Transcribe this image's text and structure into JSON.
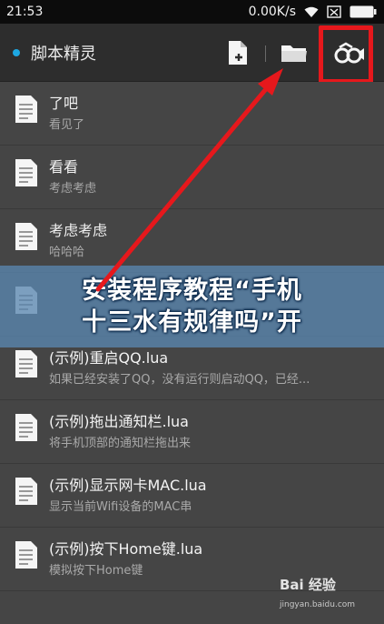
{
  "status_bar": {
    "time": "21:53",
    "net_speed": "0.00K/s"
  },
  "action_bar": {
    "app_title": "脚本精灵",
    "icons": [
      "new-script-icon",
      "folder-icon",
      "record-icon"
    ],
    "accent": "#1da7e2",
    "highlight_color": "#e6181c"
  },
  "scripts": [
    {
      "title": "了吧",
      "desc": "看见了"
    },
    {
      "title": "看看",
      "desc": "考虑考虑"
    },
    {
      "title": "考虑考虑",
      "desc": "哈哈哈"
    },
    {
      "title": "",
      "desc": ""
    },
    {
      "title": "(示例)重启QQ.lua",
      "desc": "如果已经安装了QQ，没有运行则启动QQ，已经..."
    },
    {
      "title": "(示例)拖出通知栏.lua",
      "desc": "将手机顶部的通知栏拖出来"
    },
    {
      "title": "(示例)显示网卡MAC.lua",
      "desc": "显示当前Wifi设备的MAC串"
    },
    {
      "title": "(示例)按下Home键.lua",
      "desc": "模拟按下Home键"
    }
  ],
  "overlay": {
    "line1": "安装程序教程“手机",
    "line2": "十三水有规律吗”开"
  },
  "watermark": {
    "brand": "Bai 经验",
    "url": "jingyan.baidu.com"
  }
}
